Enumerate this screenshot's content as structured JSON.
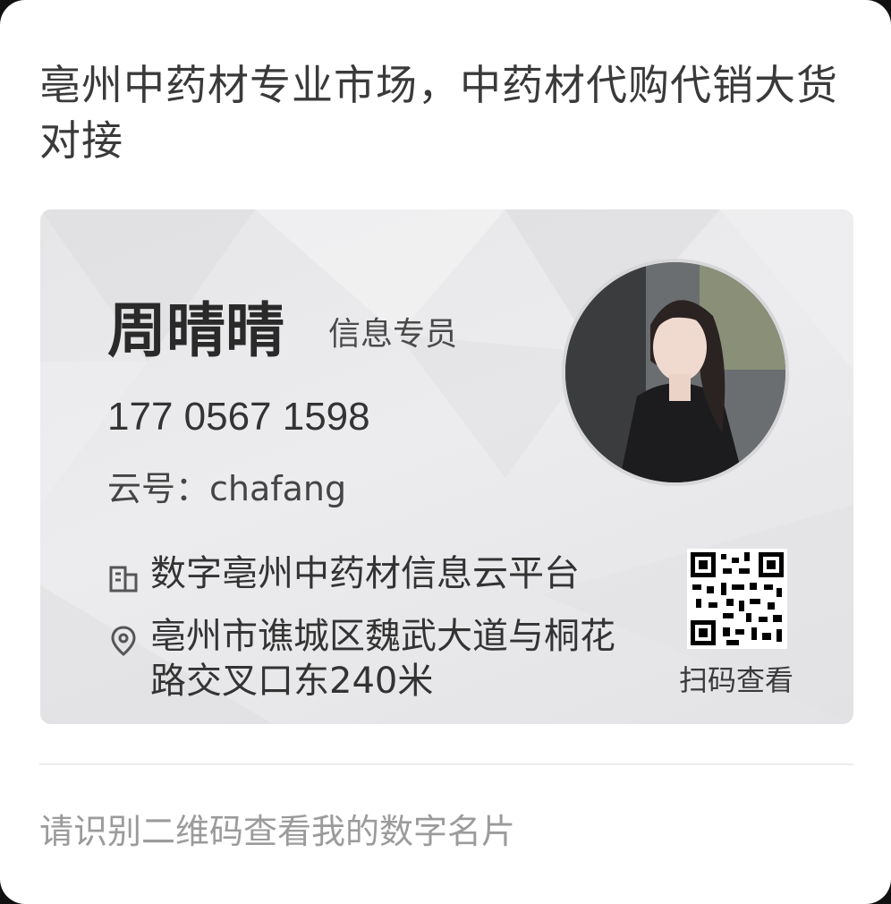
{
  "share": {
    "title": "亳州中药材专业市场，中药材代购代销大货对接"
  },
  "card": {
    "name": "周晴晴",
    "job_title": "信息专员",
    "phone": "177 0567 1598",
    "cloud_id": "云号：chafang",
    "company": "数字亳州中药材信息云平台",
    "address": "亳州市谯城区魏武大道与桐花路交叉口东240米",
    "qr_label": "扫码查看",
    "icons": {
      "company": "building-icon",
      "address": "location-pin-icon"
    }
  },
  "footer": {
    "hint": "请识别二维码查看我的数字名片"
  },
  "colors": {
    "card_background": "#e8e8ea",
    "title_text": "#3a3a3a",
    "footer_text": "#9b9b9b"
  }
}
